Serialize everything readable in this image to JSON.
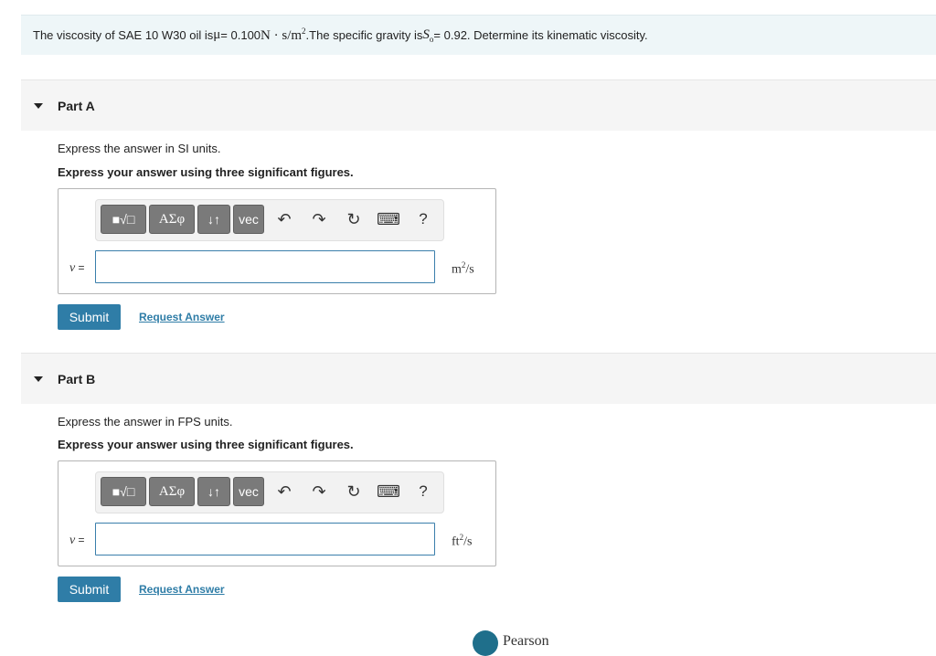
{
  "problem": {
    "prefix": "The viscosity of SAE 10 W30 oil is ",
    "mu_symbol": "μ",
    "mu_value": " = 0.100 ",
    "mu_unit": "N · s/m",
    "mu_unit_exp": "2",
    "middle": ".The specific gravity is ",
    "so_symbol": "S",
    "so_sub": "o",
    "suffix": " = 0.92. Determine its kinematic viscosity."
  },
  "toolbar": {
    "templates": "■√□",
    "greek": "ΑΣφ",
    "arrows": "↓↑",
    "vec": "vec",
    "undo": "↶",
    "redo": "↷",
    "reset": "↻",
    "keyboard": "⌨",
    "help": "?"
  },
  "parts": [
    {
      "title": "Part A",
      "instruction": "Express the answer in SI units.",
      "instruction_bold": "Express your answer using three significant figures.",
      "var_symbol": "ν",
      "var_eq": " =",
      "answer_value": "",
      "unit": "m",
      "unit_exp": "2",
      "unit_suffix": "/s",
      "submit": "Submit",
      "request": "Request Answer"
    },
    {
      "title": "Part B",
      "instruction": "Express the answer in FPS units.",
      "instruction_bold": "Express your answer using three significant figures.",
      "var_symbol": "ν",
      "var_eq": " =",
      "answer_value": "",
      "unit": "ft",
      "unit_exp": "2",
      "unit_suffix": "/s",
      "submit": "Submit",
      "request": "Request Answer"
    }
  ],
  "footer": {
    "logo_text": "Pearson"
  },
  "colors": {
    "accent": "#2f7da7",
    "problem_bg": "#eef6f8",
    "part_header_bg": "#f5f5f5",
    "toolbar_button": "#7a7a7a"
  }
}
